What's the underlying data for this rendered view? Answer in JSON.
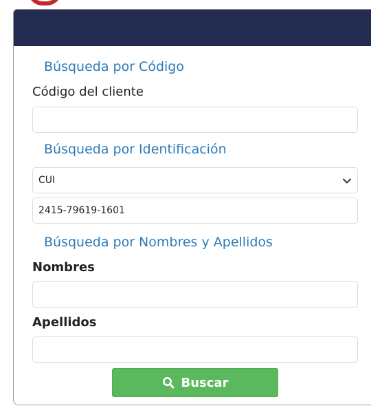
{
  "header": {
    "color": "#232b50"
  },
  "search_by_code": {
    "title": "Búsqueda por Código",
    "client_code_label": "Código del cliente",
    "client_code_value": ""
  },
  "search_by_id": {
    "title": "Búsqueda por Identificación",
    "id_type_selected": "CUI",
    "id_number_value": "2415-79619-1601"
  },
  "search_by_name": {
    "title": "Búsqueda por Nombres y Apellidos",
    "first_names_label": "Nombres",
    "first_names_value": "",
    "last_names_label": "Apellidos",
    "last_names_value": ""
  },
  "actions": {
    "search_label": "Buscar",
    "search_icon": "search-icon",
    "button_color": "#5cb85c"
  },
  "colors": {
    "section_title": "#2b7bb9",
    "logo_accent": "#c62828"
  }
}
